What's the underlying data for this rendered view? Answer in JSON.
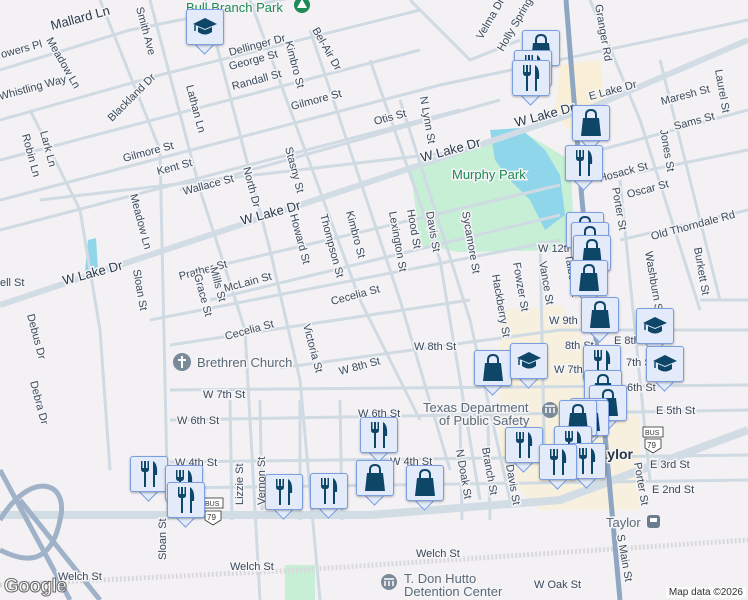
{
  "map": {
    "streets": {
      "mallard_ln": "Mallard Ln",
      "smith_ave": "Smith Ave",
      "meadow_ln_n": "Meadow Ln",
      "flowers_pl": "owers Pl",
      "whistling_way": "Whistling Way",
      "dellinger_dr": "Dellinger Dr",
      "george_st": "George St",
      "randall_st": "Randall St",
      "bel_air_dr": "Bel-Air Dr",
      "kimbro_st_n": "Kimbro St",
      "gilmore_st_e": "Gilmore St",
      "blackland_dr": "Blackland Dr",
      "lathan_ln": "Lathan Ln",
      "lark_ln": "Lark Ln",
      "robin_ln": "Robin Ln",
      "gilmore_st_w": "Gilmore St",
      "kent_st": "Kent St",
      "wallace_st": "Wallace St",
      "north_dr": "North Dr",
      "w_lake_dr_1": "W Lake Dr",
      "stasny_st": "Stasny St",
      "howard_st": "Howard St",
      "thompson_st": "Thompson St",
      "kimbro_st_s": "Kimbro St",
      "meadow_ln_s": "Meadow Ln",
      "w_lake_dr_2": "W Lake Dr",
      "prather_st": "Prather St",
      "mclain_st": "McLain St",
      "sloan_st_n": "Sloan St",
      "grace_st": "Grace St",
      "mills_st": "Mills St",
      "bell_st": "ell St",
      "cecelia_st_e": "Cecelia St",
      "cecelia_st_w": "Cecelia St",
      "debus_dr": "Debus Dr",
      "debra_dr": "Debra Dr",
      "victoria_st": "Victoria St",
      "w_8th_st_w": "W 8th St",
      "w_8th_st_e": "W 8th St",
      "w_7th_st_w": "W 7th St",
      "w_6th_st_w": "W 6th St",
      "w_4th_st_w": "W 4th St",
      "lizzie_st": "Lizzie St",
      "vernon_st": "Vernon St",
      "sloan_st_s": "Sloan St",
      "welch_st_1": "Welch St",
      "welch_st_2": "Welch St",
      "welch_st_3": "Welch St",
      "otis_st": "Otis St",
      "n_lynn_st": "N Lynn St",
      "w_lake_dr_3": "W Lake Dr",
      "w_lake_dr_4": "W Lake Dr",
      "e_lake_dr": "E Lake Dr",
      "velma_dr": "Velma Dr",
      "holly_springs": "Holly Springs",
      "granger_rd": "Granger Rd",
      "maresh_st": "Maresh St",
      "laurel_st": "Laurel St",
      "sams_st": "Sams St",
      "jones_st": "Jones St",
      "hosack_st": "Hosack St",
      "oscar_st": "Oscar St",
      "porter_st_n": "Porter St",
      "old_thorndale_rd": "Old Thorndale Rd",
      "burkett_st": "Burkett St",
      "washburn_st": "Washburn St",
      "lexington_st": "Lexington St",
      "hood_st": "Hood St",
      "davis_st_n": "Davis St",
      "sycamore_st": "Sycamore St",
      "w_12th_st": "W 12th St",
      "hackberry_st": "Hackberry St",
      "fowzer_st": "Fowzer St",
      "vance_st": "Vance St",
      "talbot_st": "Talbot St",
      "w_9th_st": "W 9th St",
      "8th_st": "8th St",
      "e_8th_st": "E 8th St",
      "w_7th_st_e": "W 7th St",
      "7th_st": "7th St",
      "6th_st": "6th St",
      "e_5th_st": "E 5th St",
      "n_doak_st": "N Doak St",
      "branch_st": "Branch St",
      "davis_st_s": "Davis St",
      "e_3rd_st": "E 3rd St",
      "e_2nd_st": "E 2nd St",
      "porter_st_s": "Porter St",
      "s_main_st": "S Main St",
      "w_oak_st": "W Oak St",
      "w_6th_st_e": "W 6th St",
      "w_4th_st_e": "W 4th St",
      "4th_st": "4th St"
    },
    "places": {
      "bull_branch_park": "Bull Branch Park",
      "murphy_park": "Murphy Park",
      "brethren_church": "Brethren Church",
      "dps_line1": "Texas Department",
      "dps_line2": "of Public Safety",
      "taylor_city": "Taylor",
      "taylor_station": "Taylor",
      "hutto_line1": "T. Don Hutto",
      "hutto_line2": "Detention Center"
    },
    "shields": {
      "bus": "BUS",
      "us79": "79"
    },
    "marker_types": [
      "school-icon",
      "restaurant-icon",
      "shopping-bag-icon"
    ],
    "colors": {
      "marker_bg": "#e3ebfb",
      "marker_icon": "#0e4668",
      "park": "#c6efd6",
      "water": "#8fd6ea",
      "highway": "#8fa6c2"
    }
  },
  "footer": {
    "attribution": "Map data ©2026",
    "logo": "Google"
  }
}
